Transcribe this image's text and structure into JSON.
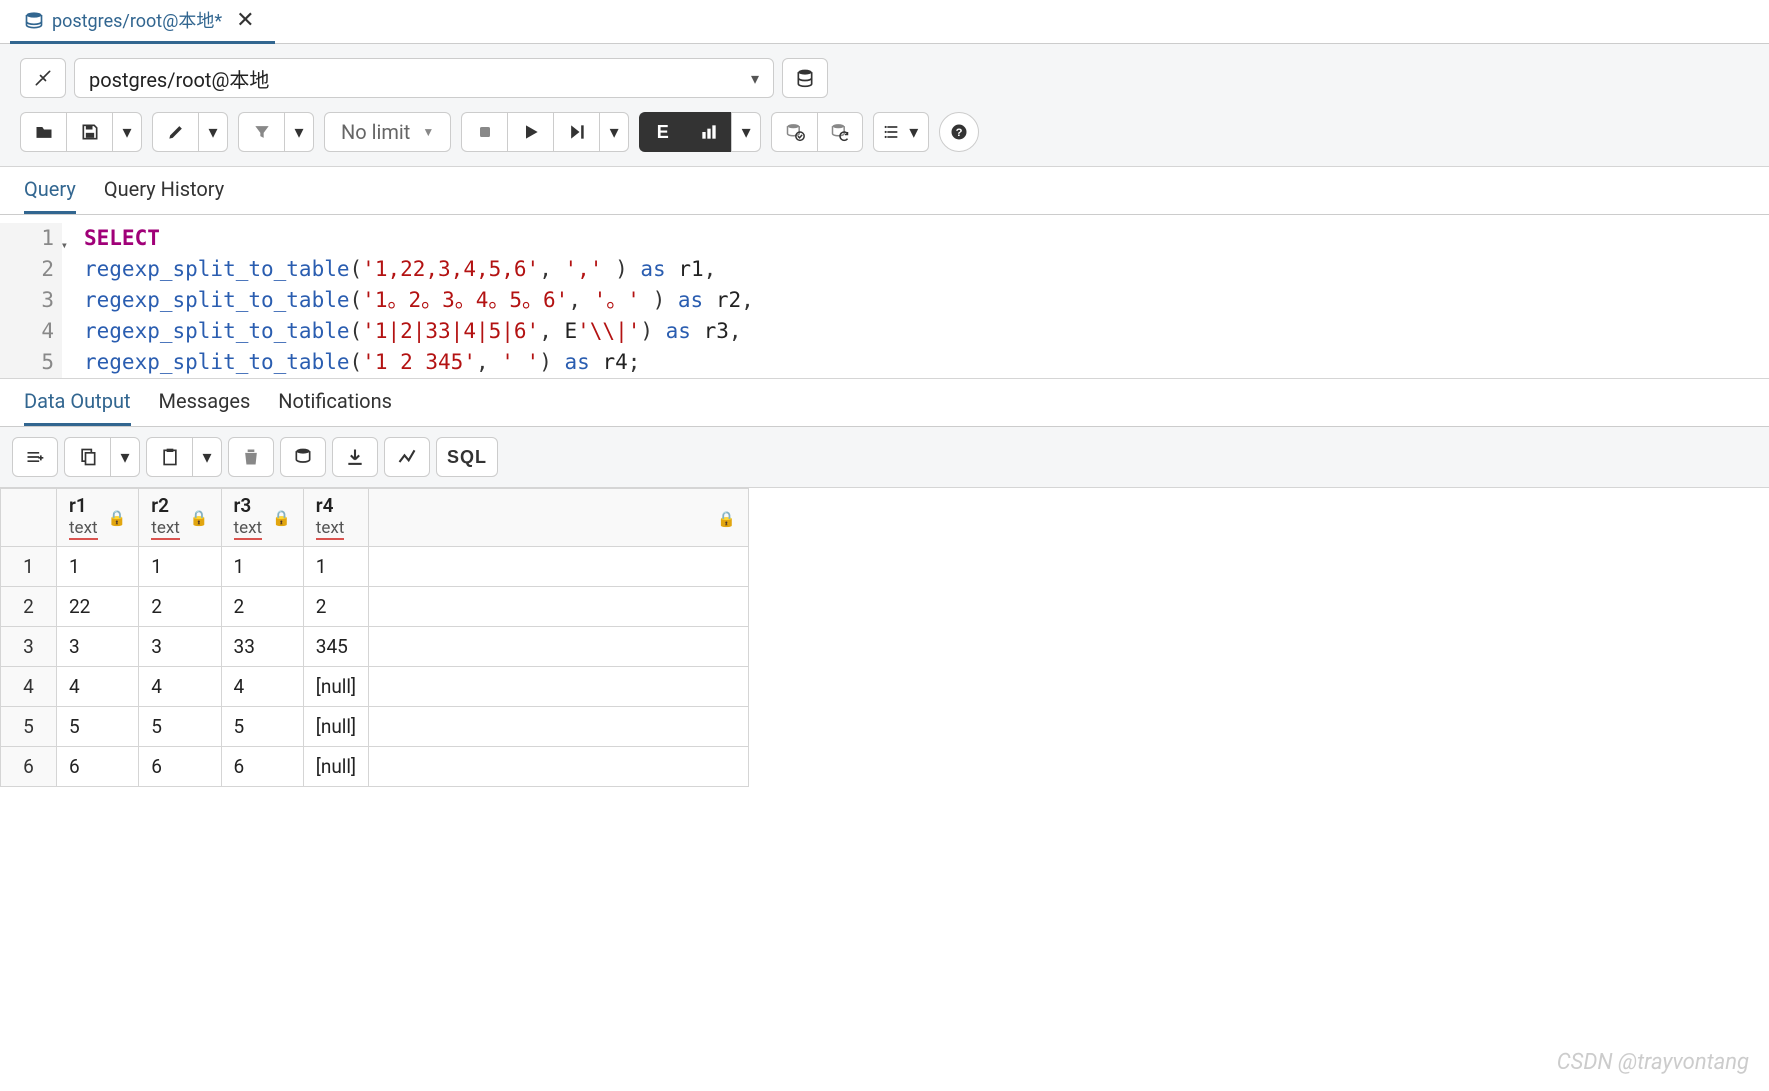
{
  "tab": {
    "title": "postgres/root@本地*",
    "close": "✕"
  },
  "connection": {
    "label": "postgres/root@本地"
  },
  "toolbar": {
    "limit": "No limit"
  },
  "subtabs": {
    "query": "Query",
    "history": "Query History"
  },
  "sql": {
    "lines": [
      1,
      2,
      3,
      4,
      5
    ],
    "kw_select": "SELECT",
    "fn": "regexp_split_to_table",
    "as": "as",
    "l2_arg1": "'1,22,3,4,5,6'",
    "l2_arg2": "','",
    "l2_alias": "r1",
    "l3_arg1": "'1。2。3。4。5。6'",
    "l3_arg2": "'。'",
    "l3_alias": "r2",
    "l4_arg1": "'1|2|33|4|5|6'",
    "l4_arg2": "'\\\\|'",
    "l4_epfx": "E",
    "l4_alias": "r3",
    "l5_arg1": "'1 2 345'",
    "l5_arg2": "' '",
    "l5_alias": "r4"
  },
  "result_tabs": {
    "data": "Data Output",
    "messages": "Messages",
    "notifications": "Notifications"
  },
  "columns": [
    {
      "name": "r1",
      "type": "text"
    },
    {
      "name": "r2",
      "type": "text"
    },
    {
      "name": "r3",
      "type": "text"
    },
    {
      "name": "r4",
      "type": "text"
    }
  ],
  "rows": [
    {
      "n": "1",
      "r1": "1",
      "r2": "1",
      "r3": "1",
      "r4": "1"
    },
    {
      "n": "2",
      "r1": "22",
      "r2": "2",
      "r3": "2",
      "r4": "2"
    },
    {
      "n": "3",
      "r1": "3",
      "r2": "3",
      "r3": "33",
      "r4": "345"
    },
    {
      "n": "4",
      "r1": "4",
      "r2": "4",
      "r3": "4",
      "r4": "[null]"
    },
    {
      "n": "5",
      "r1": "5",
      "r2": "5",
      "r3": "5",
      "r4": "[null]"
    },
    {
      "n": "6",
      "r1": "6",
      "r2": "6",
      "r3": "6",
      "r4": "[null]"
    }
  ],
  "sql_button": "SQL",
  "watermark": "CSDN @trayvontang"
}
